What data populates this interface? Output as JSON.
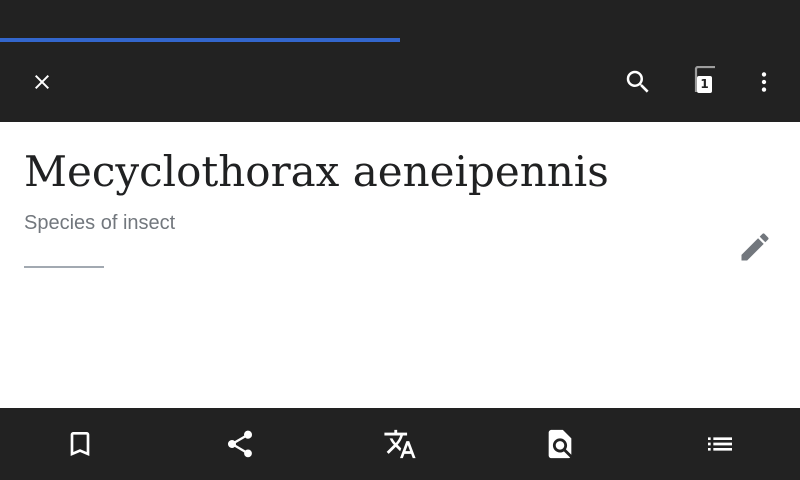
{
  "browser": {
    "load_progress_fraction": 0.5,
    "accent_color": "#3366cc",
    "bar_color": "#222222"
  },
  "toolbar": {
    "close_icon": "close-icon",
    "search_icon": "search-icon",
    "tabs_icon": "tabs-icon",
    "tabs_count": "1",
    "overflow_icon": "more-vert-icon"
  },
  "article": {
    "title": "Mecyclothorax aeneipennis",
    "description": "Species of insect",
    "edit_icon": "pencil-icon"
  },
  "bottom_bar": {
    "items": [
      {
        "name": "save",
        "icon": "bookmark-icon"
      },
      {
        "name": "share",
        "icon": "share-icon"
      },
      {
        "name": "language",
        "icon": "translate-icon"
      },
      {
        "name": "find-in-page",
        "icon": "find-in-page-icon"
      },
      {
        "name": "contents",
        "icon": "list-icon"
      }
    ]
  }
}
